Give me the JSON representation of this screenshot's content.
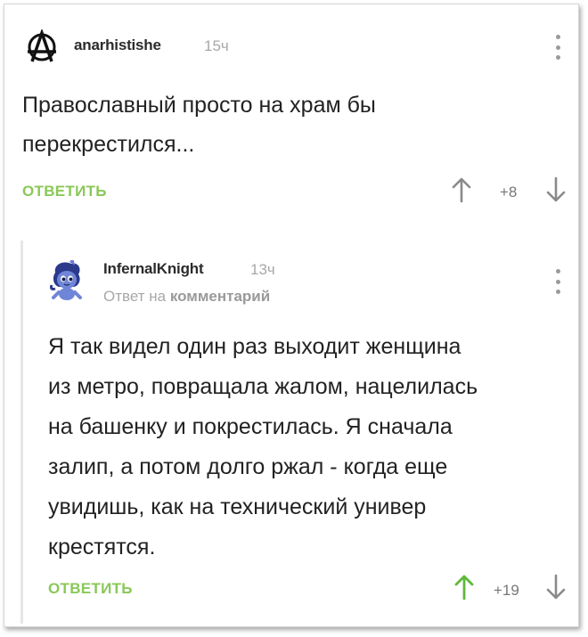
{
  "comment": {
    "author": "anarhistishe",
    "time": "15ч",
    "text_line1": "Православный просто на храм бы",
    "text_line2": "перекрестился...",
    "reply_label": "ОТВЕТИТЬ",
    "score": "+8",
    "avatar_icon": "anarchy-symbol-icon"
  },
  "reply_comment": {
    "author": "InfernalKnight",
    "time": "13ч",
    "reply_to_prefix": "Ответ на",
    "reply_to_target": "комментарий",
    "text_lines": [
      "Я так видел один раз выходит женщина",
      "из метро, повращала жалом, нацелилась",
      "на башенку и покрестилась. Я сначала",
      "залип, а потом долго ржал - когда еще",
      "увидишь, как на технический универ",
      "крестятся."
    ],
    "reply_label": "ОТВЕТИТЬ",
    "score": "+19",
    "upvoted": true,
    "avatar_icon": "pony-avatar-icon"
  },
  "colors": {
    "accent_green": "#8ac858",
    "upvote_active": "#5fb83a",
    "arrow_grey": "#8a8a8a"
  }
}
